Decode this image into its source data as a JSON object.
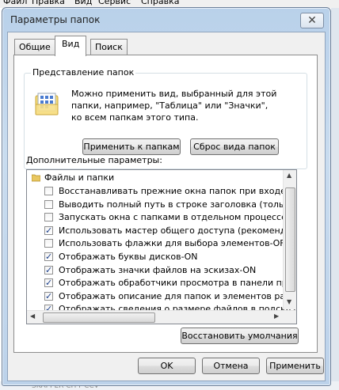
{
  "background_menu": [
    "Файл",
    "Правка",
    "Вид",
    "Сервис",
    "Справка"
  ],
  "background_status": "SKAPPER CITY CCV",
  "window": {
    "title": "Параметры папок",
    "close_symbol": "✕"
  },
  "tabs": [
    {
      "label": "Общие",
      "active": false
    },
    {
      "label": "Вид",
      "active": true
    },
    {
      "label": "Поиск",
      "active": false
    }
  ],
  "folder_view": {
    "title": "Представление папок",
    "description": [
      "Можно применить вид, выбранный для этой",
      "папки, например, \"Таблица\" или \"Значки\",",
      "ко всем папкам этого типа."
    ],
    "apply_button": "Применить к папкам",
    "reset_button": "Сброс вида папок"
  },
  "advanced": {
    "label": "Дополнительные параметры:",
    "root": "Файлы и папки",
    "items": [
      {
        "label": "Восстанавливать прежние окна папок при входе в си",
        "checked": false
      },
      {
        "label": "Выводить полный путь в строке заголовка (только д",
        "checked": false
      },
      {
        "label": "Запускать окна с папками в отдельном процессе-OFF",
        "checked": false
      },
      {
        "label": "Использовать мастер общего доступа (рекомендует",
        "checked": true
      },
      {
        "label": "Использовать флажки для выбора элементов-OFF",
        "checked": false
      },
      {
        "label": "Отображать буквы дисков-ON",
        "checked": true
      },
      {
        "label": "Отображать значки файлов на эскизах-ON",
        "checked": true
      },
      {
        "label": "Отображать обработчики просмотра в панели просм",
        "checked": true
      },
      {
        "label": "Отображать описание для папок и элементов рабоче",
        "checked": true
      },
      {
        "label": "Отображать сведения о размере файлов в подсказк",
        "checked": true
      }
    ],
    "restore_button": "Восстановить умолчания"
  },
  "footer": {
    "ok": "OK",
    "cancel": "Отмена",
    "apply": "Применить"
  }
}
